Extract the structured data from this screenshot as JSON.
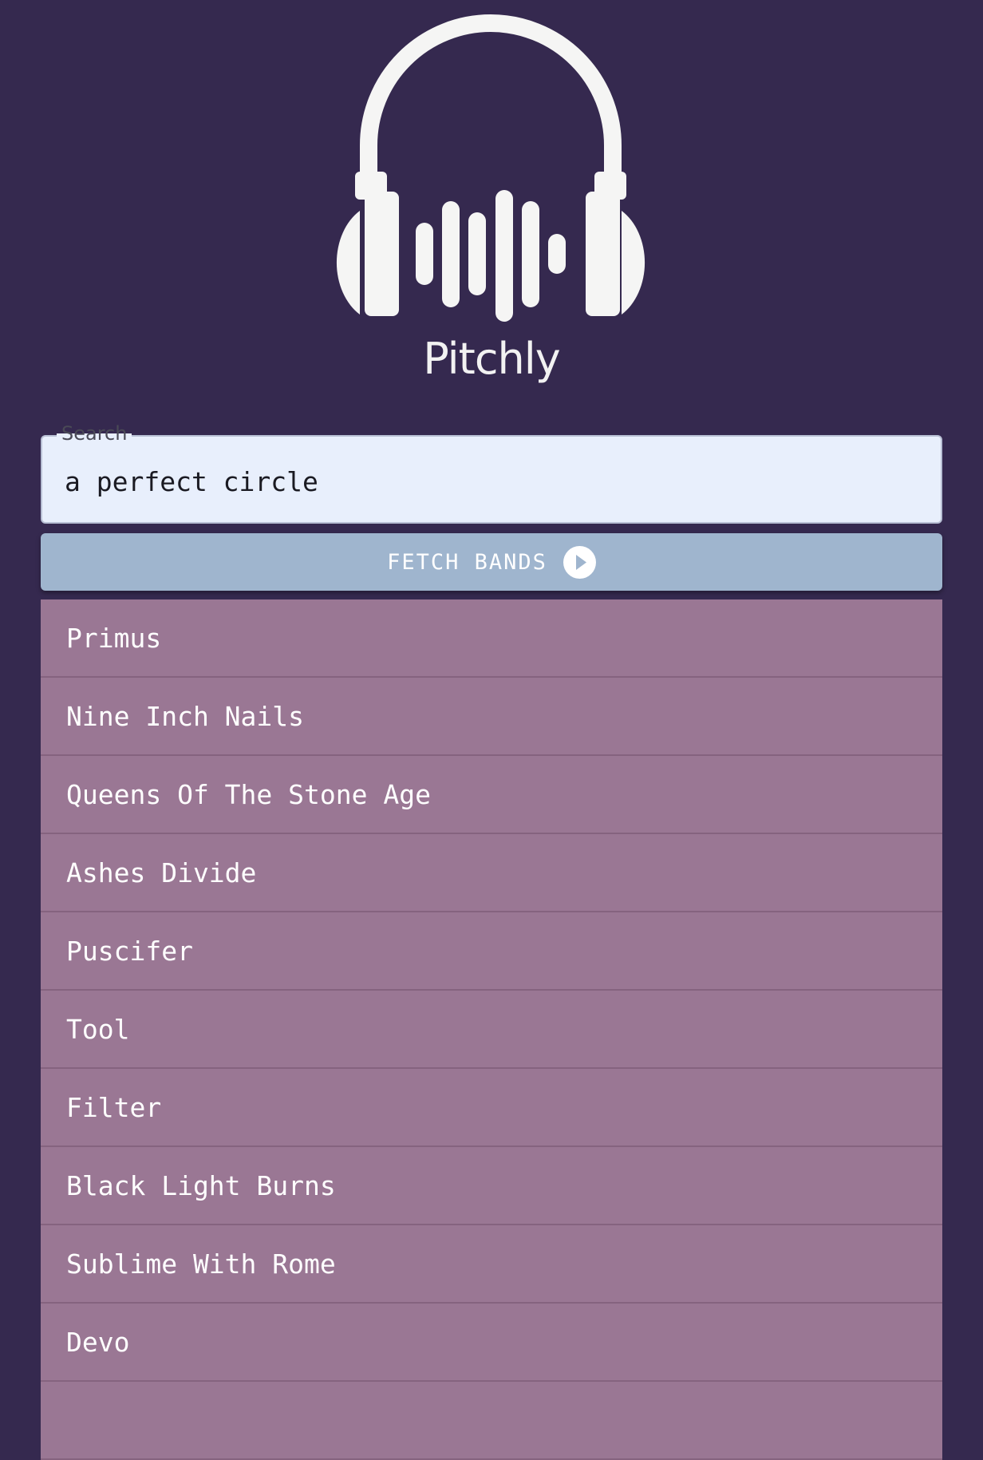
{
  "logo": {
    "name": "Pitchly",
    "icon": "headphones-soundwave-icon"
  },
  "search": {
    "label": "Search",
    "value": "a perfect circle"
  },
  "fetch_button": {
    "label": "FETCH BANDS",
    "icon": "play-circle-icon"
  },
  "results": [
    "Primus",
    "Nine Inch Nails",
    "Queens Of The Stone Age",
    "Ashes Divide",
    "Puscifer",
    "Tool",
    "Filter",
    "Black Light Burns",
    "Sublime With Rome",
    "Devo",
    ""
  ],
  "colors": {
    "background": "#35294f",
    "logo": "#f5f5f4",
    "search_field": "#e8effc",
    "button": "#9fb5ce",
    "list_item": "#9a7794"
  }
}
